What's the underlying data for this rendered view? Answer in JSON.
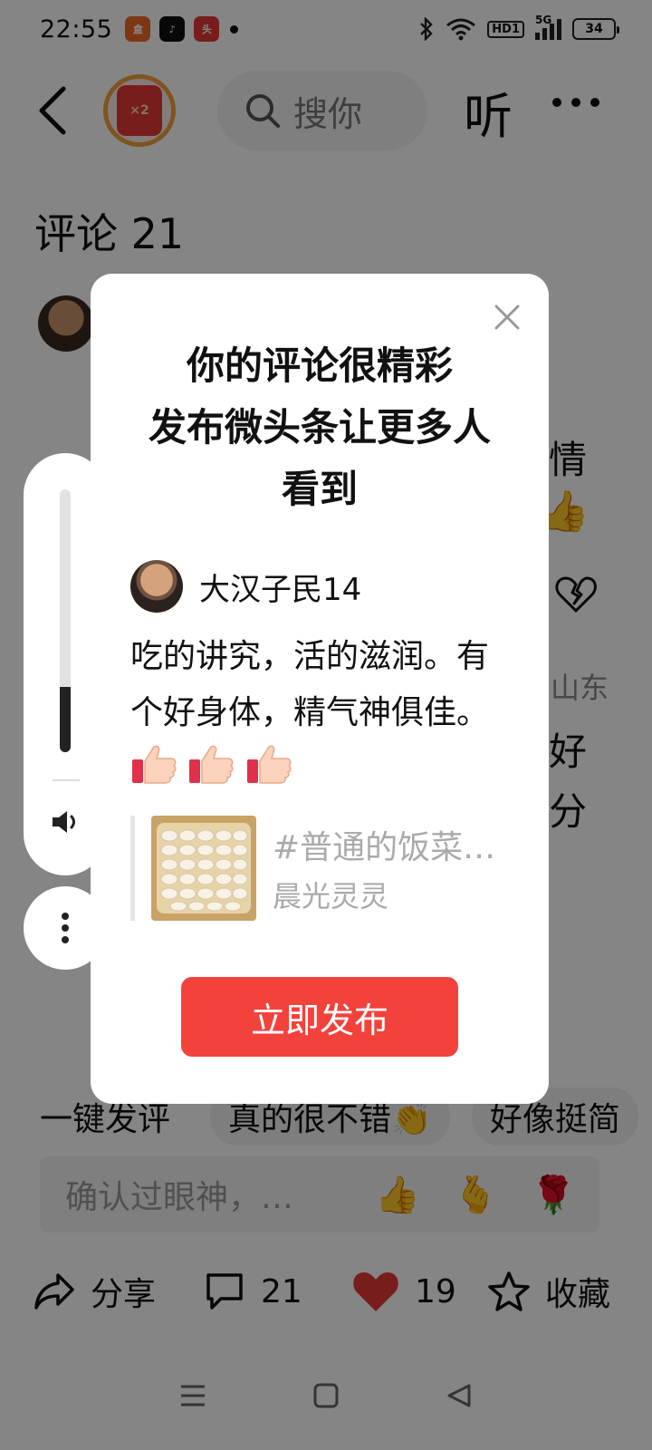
{
  "status_bar": {
    "time": "22:55",
    "network": "5G",
    "hd_badge": "HD1",
    "battery": "34"
  },
  "header": {
    "redpacket_label": "×2",
    "search_placeholder": "搜你",
    "listen_label": "听"
  },
  "comments": {
    "title": "评论 21",
    "bg_fragments": [
      "情",
      "山东",
      "好",
      "分"
    ]
  },
  "quick_replies": {
    "first": "一键发评",
    "items": [
      "真的很不错👏",
      "好像挺简"
    ]
  },
  "input_bar": {
    "placeholder": "确认过眼神，…",
    "emojis": [
      "👍",
      "🫰",
      "🌹"
    ]
  },
  "bottom_actions": {
    "share": "分享",
    "comment_count": "21",
    "like_count": "19",
    "favorite": "收藏"
  },
  "modal": {
    "title_lines": [
      "你的评论很精彩",
      "发布微头条让更多人",
      "看到"
    ],
    "username": "大汉子民14",
    "comment_text": "吃的讲究，活的滋润。有个好身体，精气神俱佳。",
    "quote_topic": "#普通的饭菜…",
    "quote_author": "晨光灵灵",
    "publish_label": "立即发布"
  },
  "volume": {
    "level": 0.25
  },
  "colors": {
    "accent_red": "#f2423b",
    "heart_red": "#e53935",
    "redpacket_ring": "#f3a23a"
  }
}
